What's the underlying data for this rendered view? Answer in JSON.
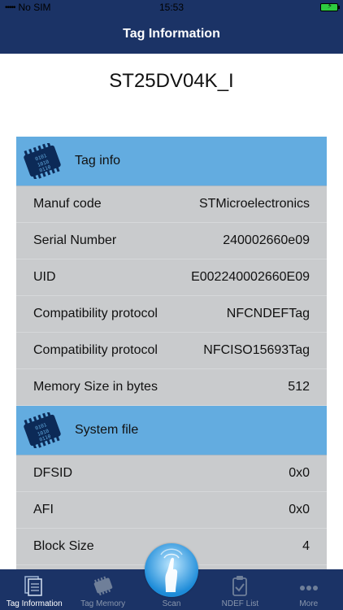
{
  "status_bar": {
    "carrier": "No SIM",
    "time": "15:53"
  },
  "nav": {
    "title": "Tag Information"
  },
  "tag_name": "ST25DV04K_I",
  "sections": [
    {
      "title": "Tag info",
      "icon": "chip-icon",
      "rows": [
        {
          "label": "Manuf code",
          "value": "STMicroelectronics"
        },
        {
          "label": "Serial Number",
          "value": "240002660e09"
        },
        {
          "label": "UID",
          "value": "E002240002660E09"
        },
        {
          "label": "Compatibility protocol",
          "value": "NFCNDEFTag"
        },
        {
          "label": "Compatibility protocol",
          "value": "NFCISO15693Tag"
        },
        {
          "label": "Memory Size in bytes",
          "value": "512"
        }
      ]
    },
    {
      "title": "System file",
      "icon": "chip-icon",
      "rows": [
        {
          "label": "DFSID",
          "value": "0x0"
        },
        {
          "label": "AFI",
          "value": "0x0"
        },
        {
          "label": "Block Size",
          "value": "4"
        }
      ]
    }
  ],
  "tab_bar": {
    "items": [
      {
        "label": "Tag Information",
        "icon": "document-stack-icon",
        "active": true
      },
      {
        "label": "Tag Memory",
        "icon": "memory-chip-icon",
        "active": false
      },
      {
        "label": "Scan",
        "icon": "nfc-scan-icon",
        "active": false
      },
      {
        "label": "NDEF List",
        "icon": "clipboard-check-icon",
        "active": false
      },
      {
        "label": "More",
        "icon": "more-dots-icon",
        "active": false
      }
    ]
  },
  "colors": {
    "nav_background": "#1b3366",
    "section_header": "#63ace0",
    "card_background": "#c9cbcd",
    "tab_inactive": "#8a97ad"
  }
}
